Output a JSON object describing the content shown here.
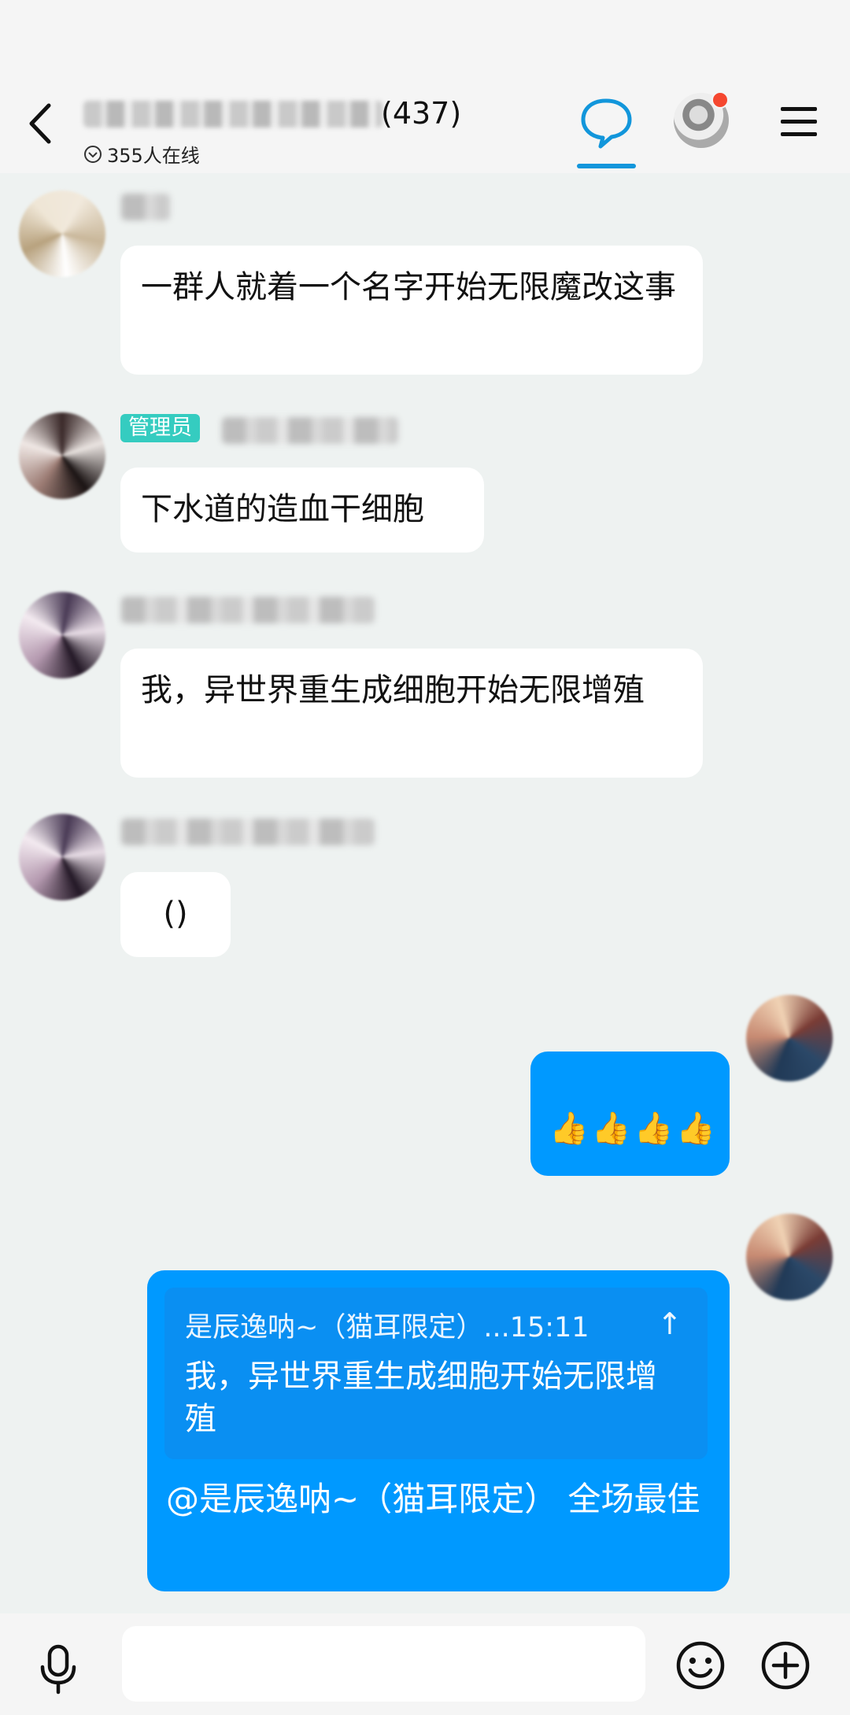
{
  "header": {
    "member_count": "(437)",
    "online_text": "355人在线",
    "accent_color": "#1296db"
  },
  "messages": [
    {
      "sender_badge": "",
      "text": "一群人就着一个名字开始无限魔改这事"
    },
    {
      "sender_badge": "管理员",
      "text": "下水道的造血干细胞"
    },
    {
      "sender_badge": "",
      "text": "我，异世界重生成细胞开始无限增殖"
    },
    {
      "sender_badge": "",
      "text": "()"
    }
  ],
  "my_messages": [
    {
      "text": "👍👍👍👍"
    },
    {
      "quote_header": "是辰逸呐~（猫耳限定）...15:11",
      "quote_arrow": "↑",
      "quote_text": "我，异世界重生成细胞开始无限增殖",
      "text": "@是辰逸呐~（猫耳限定） 全场最佳"
    }
  ],
  "bubble_color_me": "#0099ff",
  "badge_color": "#35ccc0",
  "input": {
    "placeholder": "",
    "value": ""
  },
  "icons": [
    "back-arrow-icon",
    "chat-bubble-icon",
    "menu-icon",
    "microphone-icon",
    "emoji-icon",
    "plus-icon",
    "expand-circle-icon"
  ]
}
